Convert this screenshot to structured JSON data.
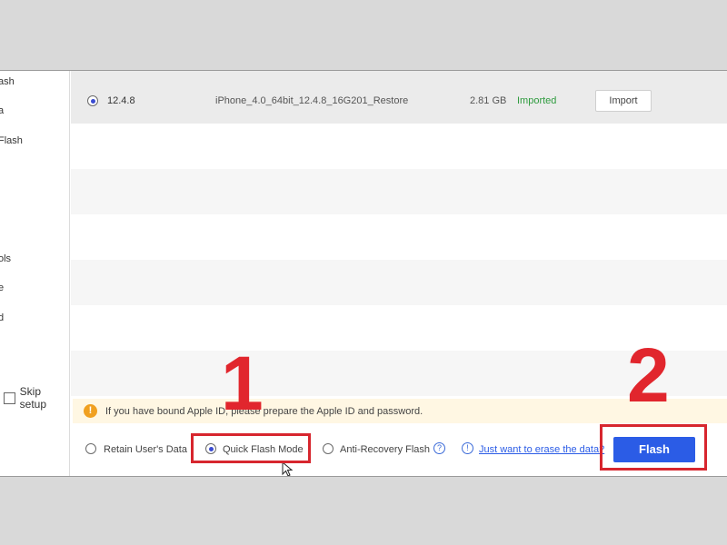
{
  "sidebar": {
    "items": [
      "ash",
      "a",
      "Flash",
      "ols",
      "e",
      "d"
    ],
    "skip_setup": "Skip setup"
  },
  "firmware": {
    "version": "12.4.8",
    "file": "iPhone_4.0_64bit_12.4.8_16G201_Restore",
    "size": "2.81 GB",
    "status": "Imported",
    "import_label": "Import"
  },
  "notice": {
    "icon": "!",
    "text": "If you have bound Apple ID, please prepare the Apple ID and password."
  },
  "options": {
    "retain": "Retain User's Data",
    "quick": "Quick Flash Mode",
    "anti": "Anti-Recovery Flash",
    "help_icon": "?",
    "info_icon": "!",
    "erase_link": "Just want to erase the data?",
    "selected": "Quick Flash Mode"
  },
  "flash_label": "Flash",
  "annotations": {
    "step1": "1",
    "step2": "2"
  },
  "colors": {
    "accent": "#2b5ce6",
    "imported": "#2e9b3e",
    "annotation": "#e1262d",
    "link": "#2b5ce6"
  }
}
